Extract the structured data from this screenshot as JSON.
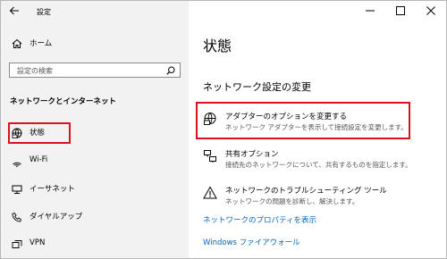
{
  "window": {
    "title": "設定",
    "back_icon": "back-arrow-icon",
    "controls": [
      "minimize-icon",
      "maximize-icon",
      "close-icon"
    ]
  },
  "sidebar": {
    "home_label": "ホーム",
    "search_placeholder": "設定の検索",
    "section_title": "ネットワークとインターネット",
    "items": [
      {
        "label": "状態",
        "icon": "status-globe-icon",
        "selected": true
      },
      {
        "label": "Wi-Fi",
        "icon": "wifi-icon"
      },
      {
        "label": "イーサネット",
        "icon": "ethernet-icon"
      },
      {
        "label": "ダイヤルアップ",
        "icon": "dialup-icon"
      },
      {
        "label": "VPN",
        "icon": "vpn-icon"
      }
    ]
  },
  "main": {
    "title": "状態",
    "subheading": "ネットワーク設定の変更",
    "settings": [
      {
        "title": "アダプターのオプションを変更する",
        "description": "ネットワーク アダプターを表示して接続設定を変更します。",
        "icon": "adapter-options-icon"
      },
      {
        "title": "共有オプション",
        "description": "接続先のネットワークについて、共有するものを指定します。",
        "icon": "sharing-options-icon"
      },
      {
        "title": "ネットワークのトラブルシューティング ツール",
        "description": "ネットワークの問題を診断し、解決します。",
        "icon": "warning-icon"
      }
    ],
    "links": [
      "ネットワークのプロパティを表示",
      "Windows ファイアウォール"
    ]
  },
  "colors": {
    "highlight": "#d8121c",
    "link": "#0067c0",
    "sidebar_bg": "#f2f2f2"
  }
}
